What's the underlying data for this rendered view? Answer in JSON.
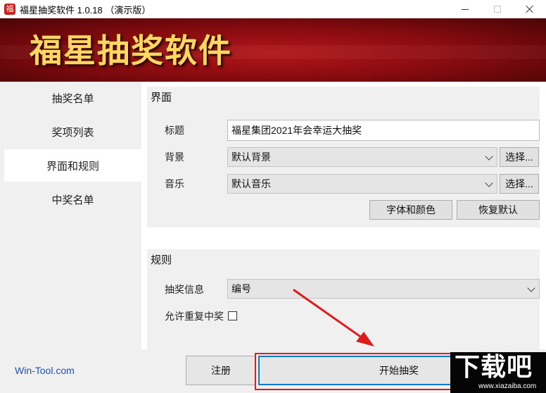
{
  "window": {
    "title": "福星抽奖软件 1.0.18  （演示版）",
    "icon_glyph": "福"
  },
  "banner": {
    "title": "福星抽奖软件"
  },
  "sidebar": {
    "items": [
      {
        "label": "抽奖名单"
      },
      {
        "label": "奖项列表"
      },
      {
        "label": "界面和规则",
        "active": true
      },
      {
        "label": "中奖名单"
      }
    ]
  },
  "interface_section": {
    "heading": "界面",
    "title_label": "标题",
    "title_value": "福星集团2021年会幸运大抽奖",
    "background_label": "背景",
    "background_value": "默认背景",
    "music_label": "音乐",
    "music_value": "默认音乐",
    "choose_label": "选择...",
    "font_color_button": "字体和颜色",
    "restore_default_button": "恢复默认"
  },
  "rules_section": {
    "heading": "规则",
    "draw_info_label": "抽奖信息",
    "draw_info_value": "编号",
    "allow_repeat_label": "允许重复中奖",
    "allow_repeat_checked": false
  },
  "footer": {
    "link": "Win-Tool.com",
    "register_button": "注册",
    "start_button": "开始抽奖"
  },
  "watermark": {
    "logo": "下载吧",
    "url": "www.xiazaiba.com"
  },
  "colors": {
    "banner_red": "#8c0c10",
    "banner_text": "#ffd864",
    "link_blue": "#1a4fc9",
    "highlight_red": "#e01b1b",
    "focus_blue": "#0f7ad6"
  }
}
